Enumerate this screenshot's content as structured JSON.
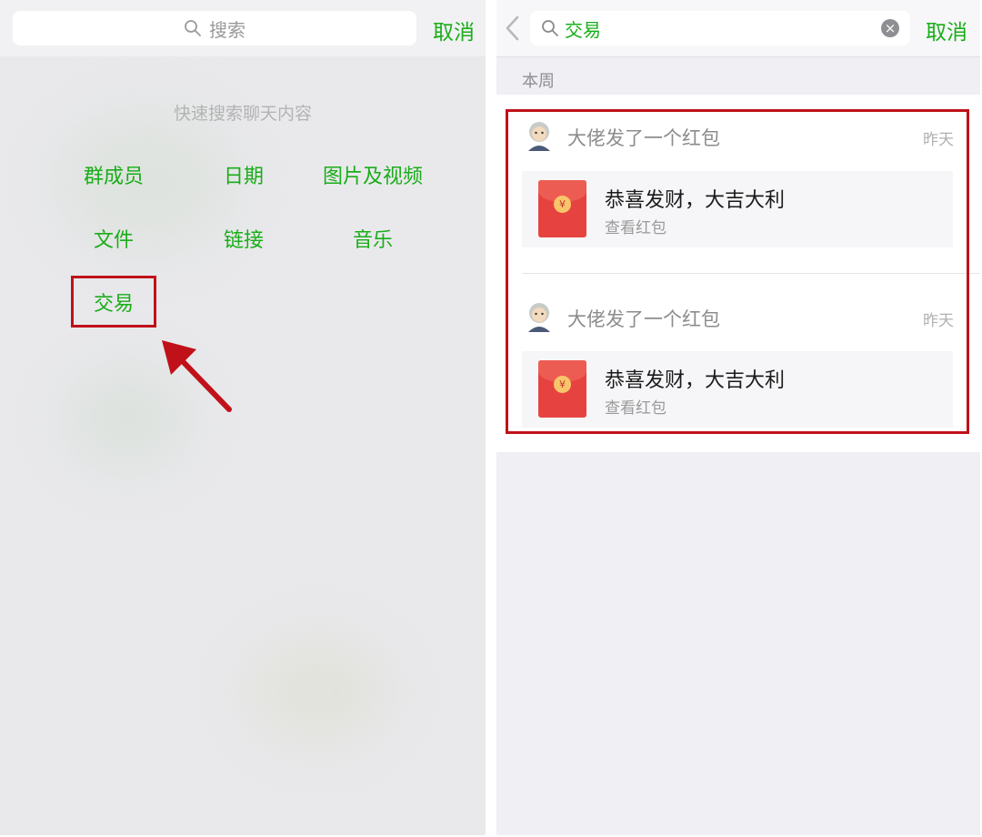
{
  "left": {
    "search": {
      "placeholder": "搜索",
      "icon": "search-icon"
    },
    "cancel_label": "取消",
    "quick_search_title": "快速搜索聊天内容",
    "categories": [
      "群成员",
      "日期",
      "图片及视频",
      "文件",
      "链接",
      "音乐",
      "交易"
    ],
    "highlighted_category": "交易"
  },
  "right": {
    "search": {
      "query": "交易",
      "icon": "search-icon"
    },
    "cancel_label": "取消",
    "section_label": "本周",
    "results": [
      {
        "sender_line": "大佬发了一个红包",
        "date": "昨天",
        "card_title": "恭喜发财，大吉大利",
        "card_subtitle": "查看红包",
        "card_icon": "red-packet-icon"
      },
      {
        "sender_line": "大佬发了一个红包",
        "date": "昨天",
        "card_title": "恭喜发财，大吉大利",
        "card_subtitle": "查看红包",
        "card_icon": "red-packet-icon"
      }
    ]
  },
  "colors": {
    "accent_green": "#1aad19",
    "highlight_red": "#c0111a",
    "red_packet": "#e64340"
  }
}
